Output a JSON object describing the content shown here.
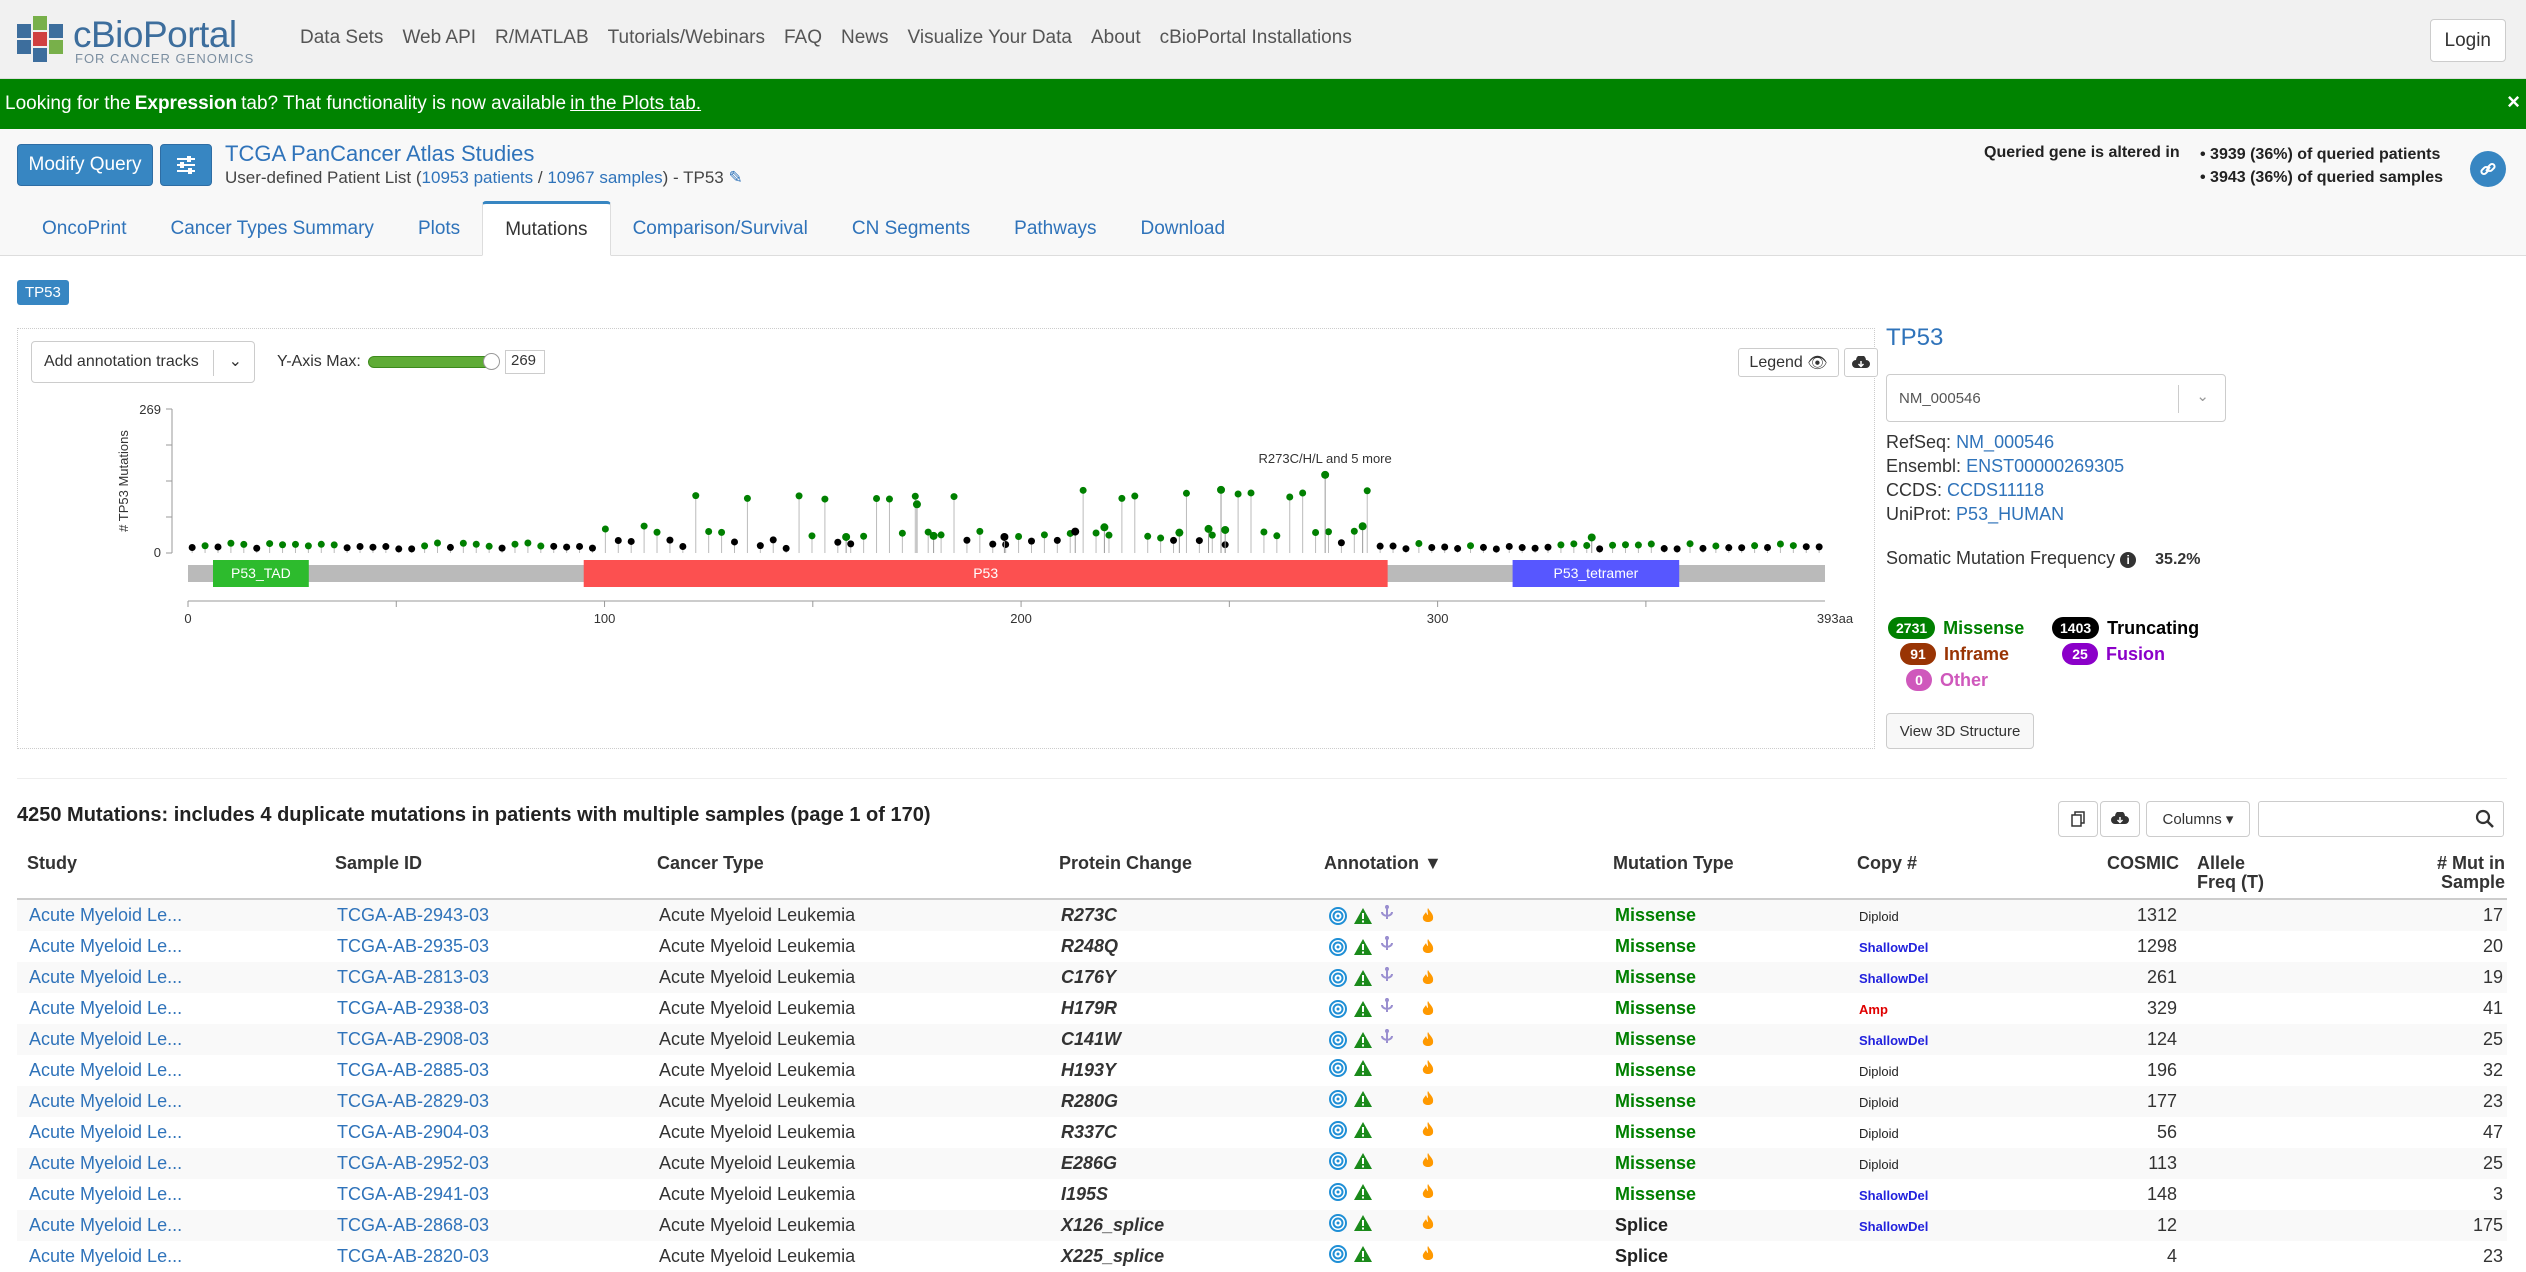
{
  "brand": {
    "title": "cBioPortal",
    "subtitle": "FOR CANCER GENOMICS"
  },
  "nav": {
    "links": [
      "Data Sets",
      "Web API",
      "R/MATLAB",
      "Tutorials/Webinars",
      "FAQ",
      "News",
      "Visualize Your Data",
      "About",
      "cBioPortal Installations"
    ],
    "login": "Login"
  },
  "banner": {
    "pre": "Looking for the",
    "bold": "Expression",
    "mid": "tab? That functionality is now available",
    "link": "in the Plots tab.",
    "close": "×"
  },
  "query": {
    "modify": "Modify Query",
    "study": "TCGA PanCancer Atlas Studies",
    "list_pre": "User-defined Patient List (",
    "patients": "10953",
    "patients_label": "patients",
    "slash": "/",
    "samples": "10967",
    "samples_label": "samples",
    "list_post": ")  - TP53",
    "altered_label": "Queried gene is altered in",
    "altered_patients": "• 3939 (36%) of queried patients",
    "altered_samples": "• 3943 (36%) of queried samples"
  },
  "tabs": [
    "OncoPrint",
    "Cancer Types Summary",
    "Plots",
    "Mutations",
    "Comparison/Survival",
    "CN Segments",
    "Pathways",
    "Download"
  ],
  "active_tab": "Mutations",
  "gene_pill": "TP53",
  "lollipop": {
    "annotation_dropdown": "Add annotation tracks",
    "ymax_label": "Y-Axis Max:",
    "ymax_value": "269",
    "legend_btn": "Legend",
    "y_axis_label": "# TP53 Mutations",
    "y_top": "269",
    "y_zero": "0",
    "top_label": "R273C/H/L and 5 more",
    "x_ticks": [
      "0",
      "100",
      "200",
      "300",
      "393aa"
    ],
    "domains": [
      {
        "name": "P53_TAD",
        "start": 6,
        "end": 29,
        "color": "#2dbb2d"
      },
      {
        "name": "P53",
        "start": 95,
        "end": 288,
        "color": "#fc5050"
      },
      {
        "name": "P53_tetramer",
        "start": 318,
        "end": 358,
        "color": "#5757ff"
      }
    ],
    "protein_length": 393,
    "y_max": 269
  },
  "gene_panel": {
    "name": "TP53",
    "transcript": "NM_000546",
    "refseq_label": "RefSeq:",
    "refseq": "NM_000546",
    "ensembl_label": "Ensembl:",
    "ensembl": "ENST00000269305",
    "ccds_label": "CCDS:",
    "ccds": "CCDS11118",
    "uniprot_label": "UniProt:",
    "uniprot": "P53_HUMAN",
    "smf_label": "Somatic Mutation Frequency",
    "smf_value": "35.2%",
    "mutation_types": {
      "missense": {
        "count": "2731",
        "label": "Missense"
      },
      "truncating": {
        "count": "1403",
        "label": "Truncating"
      },
      "inframe": {
        "count": "91",
        "label": "Inframe"
      },
      "fusion": {
        "count": "25",
        "label": "Fusion"
      },
      "other": {
        "count": "0",
        "label": "Other"
      }
    },
    "view3d": "View 3D Structure"
  },
  "table": {
    "summary": "4250 Mutations: includes 4 duplicate mutations in patients with multiple samples (page 1 of 170)",
    "columns_btn": "Columns ▾",
    "headers": {
      "study": "Study",
      "sample": "Sample ID",
      "cancer": "Cancer Type",
      "protein": "Protein Change",
      "annotation": "Annotation ▼",
      "mtype": "Mutation Type",
      "copy": "Copy #",
      "cosmic": "COSMIC",
      "allele": "Allele Freq (T)",
      "mut": "# Mut in Sample"
    },
    "rows": [
      {
        "study": "Acute Myeloid Le...",
        "sample": "TCGA-AB-2943-03",
        "cancer": "Acute Myeloid Leukemia",
        "protein": "R273C",
        "mtype": "Missense",
        "copy": "Diploid",
        "cosmic": "1312",
        "mut": "17"
      },
      {
        "study": "Acute Myeloid Le...",
        "sample": "TCGA-AB-2935-03",
        "cancer": "Acute Myeloid Leukemia",
        "protein": "R248Q",
        "mtype": "Missense",
        "copy": "ShallowDel",
        "cosmic": "1298",
        "mut": "20"
      },
      {
        "study": "Acute Myeloid Le...",
        "sample": "TCGA-AB-2813-03",
        "cancer": "Acute Myeloid Leukemia",
        "protein": "C176Y",
        "mtype": "Missense",
        "copy": "ShallowDel",
        "cosmic": "261",
        "mut": "19"
      },
      {
        "study": "Acute Myeloid Le...",
        "sample": "TCGA-AB-2938-03",
        "cancer": "Acute Myeloid Leukemia",
        "protein": "H179R",
        "mtype": "Missense",
        "copy": "Amp",
        "cosmic": "329",
        "mut": "41"
      },
      {
        "study": "Acute Myeloid Le...",
        "sample": "TCGA-AB-2908-03",
        "cancer": "Acute Myeloid Leukemia",
        "protein": "C141W",
        "mtype": "Missense",
        "copy": "ShallowDel",
        "cosmic": "124",
        "mut": "25"
      },
      {
        "study": "Acute Myeloid Le...",
        "sample": "TCGA-AB-2885-03",
        "cancer": "Acute Myeloid Leukemia",
        "protein": "H193Y",
        "mtype": "Missense",
        "copy": "Diploid",
        "cosmic": "196",
        "mut": "32"
      },
      {
        "study": "Acute Myeloid Le...",
        "sample": "TCGA-AB-2829-03",
        "cancer": "Acute Myeloid Leukemia",
        "protein": "R280G",
        "mtype": "Missense",
        "copy": "Diploid",
        "cosmic": "177",
        "mut": "23"
      },
      {
        "study": "Acute Myeloid Le...",
        "sample": "TCGA-AB-2904-03",
        "cancer": "Acute Myeloid Leukemia",
        "protein": "R337C",
        "mtype": "Missense",
        "copy": "Diploid",
        "cosmic": "56",
        "mut": "47"
      },
      {
        "study": "Acute Myeloid Le...",
        "sample": "TCGA-AB-2952-03",
        "cancer": "Acute Myeloid Leukemia",
        "protein": "E286G",
        "mtype": "Missense",
        "copy": "Diploid",
        "cosmic": "113",
        "mut": "25"
      },
      {
        "study": "Acute Myeloid Le...",
        "sample": "TCGA-AB-2941-03",
        "cancer": "Acute Myeloid Leukemia",
        "protein": "I195S",
        "mtype": "Missense",
        "copy": "ShallowDel",
        "cosmic": "148",
        "mut": "3"
      },
      {
        "study": "Acute Myeloid Le...",
        "sample": "TCGA-AB-2868-03",
        "cancer": "Acute Myeloid Leukemia",
        "protein": "X126_splice",
        "mtype": "Splice",
        "copy": "ShallowDel",
        "cosmic": "12",
        "mut": "175"
      },
      {
        "study": "Acute Myeloid Le...",
        "sample": "TCGA-AB-2820-03",
        "cancer": "Acute Myeloid Leukemia",
        "protein": "X225_splice",
        "mtype": "Splice",
        "copy": "",
        "cosmic": "4",
        "mut": "23"
      }
    ]
  }
}
